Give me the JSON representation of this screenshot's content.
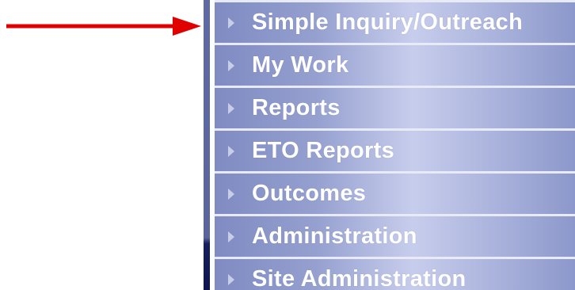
{
  "annotation": {
    "arrow_color": "#e00000"
  },
  "menu": {
    "items": [
      {
        "label": "Simple Inquiry/Outreach",
        "icon": "chevron-right-icon"
      },
      {
        "label": "My Work",
        "icon": "chevron-right-icon"
      },
      {
        "label": "Reports",
        "icon": "chevron-right-icon"
      },
      {
        "label": "ETO Reports",
        "icon": "chevron-right-icon"
      },
      {
        "label": "Outcomes",
        "icon": "chevron-right-icon"
      },
      {
        "label": "Administration",
        "icon": "chevron-right-icon"
      },
      {
        "label": "Site Administration",
        "icon": "chevron-right-icon"
      }
    ]
  },
  "colors": {
    "menu_gradient_light": "#c7cdec",
    "menu_gradient_dark": "#7f8bc2",
    "separator": "#e8ebf6",
    "label": "#ffffff"
  }
}
